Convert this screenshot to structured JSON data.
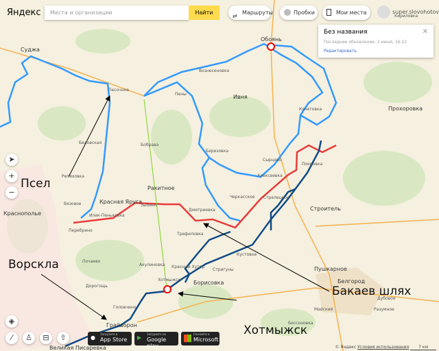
{
  "header": {
    "logo": "Яндекс",
    "search_placeholder": "Места и организации",
    "search_button": "Найти",
    "routes": "Маршруты",
    "traffic": "Пробки",
    "my_places": "Мои места",
    "user": "super.slovohotov"
  },
  "panel": {
    "title": "Без названия",
    "updated": "Последнее обновление: 2 июня, 16:22",
    "edit": "Редактировать"
  },
  "annotations": {
    "psel": "Псел",
    "vorskla": "Ворскла",
    "bakaev": "Бакаев шлях",
    "khotmyzhsk": "Хотмыжск"
  },
  "places": [
    "Суджа",
    "Обоянь",
    "Ивня",
    "Ракитное",
    "Красная Яруга",
    "Илек-Пеньковка",
    "Дмитриевка",
    "Трефиловка",
    "Красный Хутор",
    "Хотмыжск",
    "Борисовка",
    "Грайворон",
    "Великая Писаревка",
    "Белгород",
    "Строитель",
    "Прохоровка",
    "Пушкарное",
    "Стрелецкое",
    "Покровка",
    "Бобрава",
    "Пены",
    "Кочетовка",
    "Вязовое",
    "Перебрино",
    "Краснополье",
    "Дорогощь",
    "Почаево",
    "Акулиновка",
    "Кустовое",
    "Майский",
    "Разумное",
    "Дубовое",
    "Бессоновка",
    "Стригуны",
    "Головчино",
    "Кириловка",
    "Репяховка",
    "Песочное",
    "Зыбино",
    "Беловская",
    "Черкасское",
    "Алексеевка",
    "Березовка",
    "Сырцево",
    "Вознесеновка"
  ],
  "stores": [
    {
      "small": "Загрузите в",
      "label": "App Store"
    },
    {
      "small": "Загрузите на",
      "label": "Google play"
    },
    {
      "small": "Скачайте в",
      "label": "Microsoft"
    }
  ],
  "footer": {
    "copyright": "© Яндекс",
    "terms": "Условия использования",
    "scale": "7 км"
  },
  "colors": {
    "route_light_blue": "#3399ff",
    "route_red": "#e83b3b",
    "route_dark_blue": "#0e4a86",
    "line_green": "#7ed321",
    "marker": "#e60000"
  }
}
